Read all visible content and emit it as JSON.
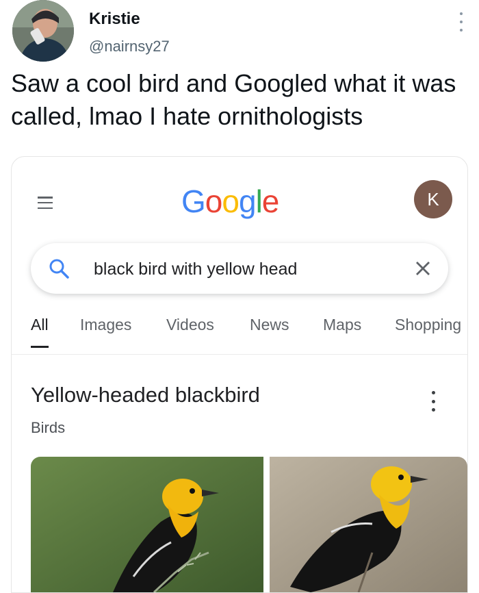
{
  "tweet": {
    "name": "Kristie",
    "handle": "@nairnsy27",
    "text": "Saw a cool bird and Googled what it was called, lmao I hate ornithologists"
  },
  "google": {
    "logo_letters": [
      "G",
      "o",
      "o",
      "g",
      "l",
      "e"
    ],
    "logo_colors": [
      "#4285F4",
      "#EA4335",
      "#FBBC05",
      "#4285F4",
      "#34A853",
      "#EA4335"
    ],
    "account_initial": "K",
    "account_color": "#7b5a4d",
    "search": {
      "query": "black bird with yellow head"
    },
    "tabs": [
      {
        "label": "All",
        "active": true
      },
      {
        "label": "Images"
      },
      {
        "label": "Videos"
      },
      {
        "label": "News"
      },
      {
        "label": "Maps"
      },
      {
        "label": "Shopping"
      }
    ],
    "result": {
      "title": "Yellow-headed blackbird",
      "subtitle": "Birds"
    },
    "icons": [
      "menu-icon",
      "search-icon",
      "close-icon",
      "more-vert-icon"
    ]
  }
}
